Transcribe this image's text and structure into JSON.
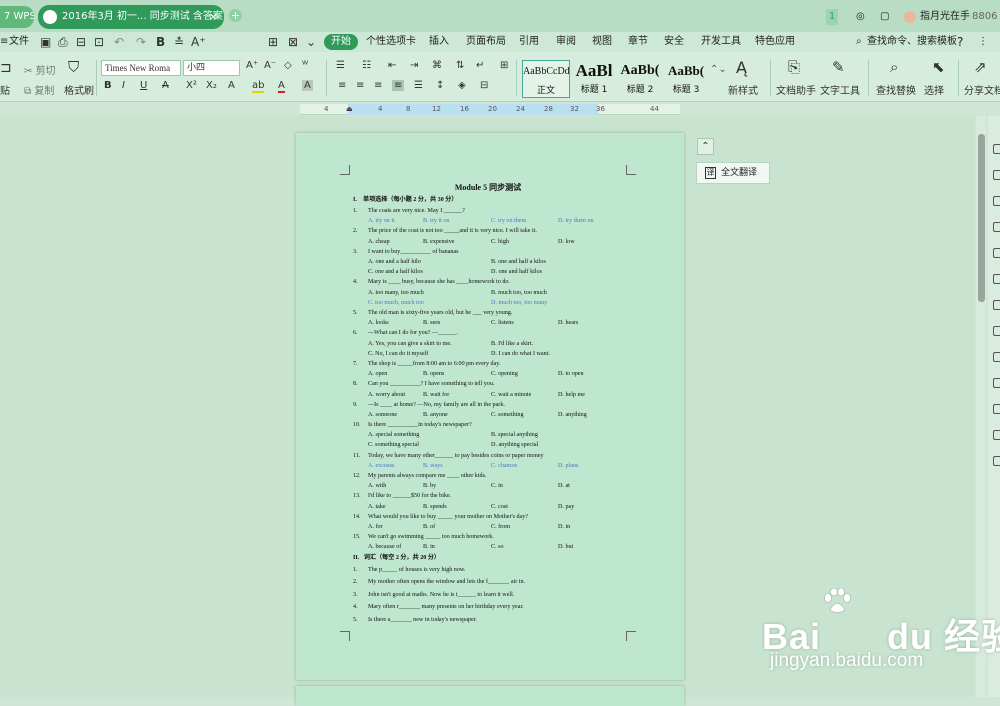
{
  "titlebar": {
    "wps_tab": "WPS",
    "doc_tab": "2016年3月 初一... 同步测试 含答案",
    "badge": "1",
    "user": "指月光在手",
    "phone": "8806",
    "close": "×",
    "add": "+"
  },
  "menu": {
    "file": "文件",
    "font_combo": "小四",
    "tabs": [
      "开始",
      "个性选项卡",
      "插入",
      "页面布局",
      "引用",
      "审阅",
      "视图",
      "章节",
      "安全",
      "开发工具",
      "特色应用"
    ],
    "search": "查找命令、搜索模板",
    "help": "?"
  },
  "ribbon": {
    "cut": "剪切",
    "copy": "复制",
    "paste_tail": "贴",
    "format_painter": "格式刷",
    "font_name": "Times New Roma",
    "font_size": "小四",
    "styles": [
      {
        "preview": "AaBbCcDd",
        "label": "正文"
      },
      {
        "preview": "AaBl",
        "label": "标题 1"
      },
      {
        "preview": "AaBb(",
        "label": "标题 2"
      },
      {
        "preview": "AaBb(",
        "label": "标题 3"
      }
    ],
    "new_style": "新样式",
    "doc_helper": "文档助手",
    "text_tool": "文字工具",
    "find_replace": "查找替换",
    "select": "选择",
    "share": "分享文档"
  },
  "ruler": {
    "ticks": [
      "4",
      "2",
      "4",
      "8",
      "12",
      "16",
      "20",
      "24",
      "28",
      "32",
      "36",
      "44"
    ]
  },
  "side": {
    "collapse_icon": "⌃",
    "translate": "全文翻译",
    "translate_icon": "译"
  },
  "document": {
    "title": "Module 5 同步测试",
    "section1": {
      "num": "I.",
      "heading": "单项选择（每小题 2 分，共 30 分）"
    },
    "questions": [
      {
        "n": "1.",
        "q": "The coats are very nice. May I ______?",
        "rows": [
          [
            "A. try on it",
            "B. try it on",
            "C. try on them",
            "D. try them on"
          ]
        ],
        "blue": true
      },
      {
        "n": "2.",
        "q": "The price of the coat is not too _____and it is very nice. I will take it.",
        "rows": [
          [
            "A. cheap",
            "B. expensive",
            "C. high",
            "D. low"
          ]
        ]
      },
      {
        "n": "3.",
        "q": "I want to buy__________ of bananas",
        "rows": [
          [
            "A. one and a half kilo",
            "",
            "B. one and half a kilos",
            ""
          ],
          [
            "C. one and a half kilos",
            "",
            "D. one and half kilos",
            ""
          ]
        ]
      },
      {
        "n": "4.",
        "q": "Mary is ____ busy, because she has ____homework to do.",
        "rows": [
          [
            "A. too many, too much",
            "",
            "B. much too, too much",
            ""
          ],
          [
            "C. too much, much too",
            "",
            "D. much too, too many",
            ""
          ]
        ],
        "blue_second": true
      },
      {
        "n": "5.",
        "q": "The old man is sixty-five years old, but he ___ very young.",
        "rows": [
          [
            "A. looks",
            "B. sees",
            "C. listens",
            "D. hears"
          ]
        ]
      },
      {
        "n": "6.",
        "q": "—What can I do for you? —______.",
        "rows": [
          [
            "A. Yes, you can give a skirt to me.",
            "",
            "B. I'd like a skirt.",
            ""
          ],
          [
            "C. No, I can do it myself",
            "",
            "D. I can do what I want.",
            ""
          ]
        ]
      },
      {
        "n": "7.",
        "q": "The shop is _____from 8:00 am to 6:00 pm every day.",
        "rows": [
          [
            "A. open",
            "B. opens",
            "C. opening",
            "D. to open"
          ]
        ]
      },
      {
        "n": "8.",
        "q": "Can you __________? I have something to tell you.",
        "rows": [
          [
            "A. worry about",
            "B. wait for",
            "C. wait a minute",
            "D. help me"
          ]
        ]
      },
      {
        "n": "9.",
        "q": "—Is ____ at home?    —No, my family are all in the park.",
        "rows": [
          [
            "A. someone",
            "B. anyone",
            "C. something",
            "D. anything"
          ]
        ]
      },
      {
        "n": "10.",
        "q": "Is there __________in today's newspaper?",
        "rows": [
          [
            "A. special something",
            "",
            "B. special anything",
            ""
          ],
          [
            "C. something special",
            "",
            "D. anything special",
            ""
          ]
        ]
      },
      {
        "n": "11.",
        "q": "Today, we have many other______ to pay besides coins or paper money",
        "rows": [
          [
            "A. excuses",
            "B. ways",
            "C. chances",
            "D. plans"
          ]
        ],
        "blue": true
      },
      {
        "n": "12.",
        "q": "My parents always compare me ____ other kids.",
        "rows": [
          [
            "A. with",
            "B. by",
            "C. in",
            "D. at"
          ]
        ]
      },
      {
        "n": "13.",
        "q": "I'd like to ______$50 for the bike.",
        "rows": [
          [
            "A. take",
            "B. spends",
            "C. cost",
            "D. pay"
          ]
        ]
      },
      {
        "n": "14.",
        "q": "What would you like to buy _____ your mother on Mother's day?",
        "rows": [
          [
            "A. for",
            "B. of",
            "C. from",
            "D. in"
          ]
        ]
      },
      {
        "n": "15.",
        "q": "We can't go swimming _____ too much homework.",
        "rows": [
          [
            "A. because of",
            "B. in",
            "C. so",
            "D. but"
          ]
        ]
      }
    ],
    "section2": {
      "num": "II.",
      "heading": "词汇（每空 2 分，共 20 分）"
    },
    "fills": [
      {
        "n": "1.",
        "t": "The p_____ of houses is very high now."
      },
      {
        "n": "2.",
        "t": "My mother often opens the window and lets the f_______ air in."
      },
      {
        "n": "3.",
        "t": "John isn't good at maths. Now he is t______ to learn it well."
      },
      {
        "n": "4.",
        "t": "Mary often r_______ many presents on her birthday every year."
      },
      {
        "n": "5.",
        "t": "Is there a_______ new in today's newspaper."
      }
    ]
  },
  "watermark": {
    "brand": "Bai      du 经验",
    "url": "jingyan.baidu.com"
  },
  "colors": {
    "accent": "#2f9a5a",
    "page": "#bfe6cf",
    "workspace": "#c8e4d0",
    "blue_text": "#4a78c8"
  }
}
